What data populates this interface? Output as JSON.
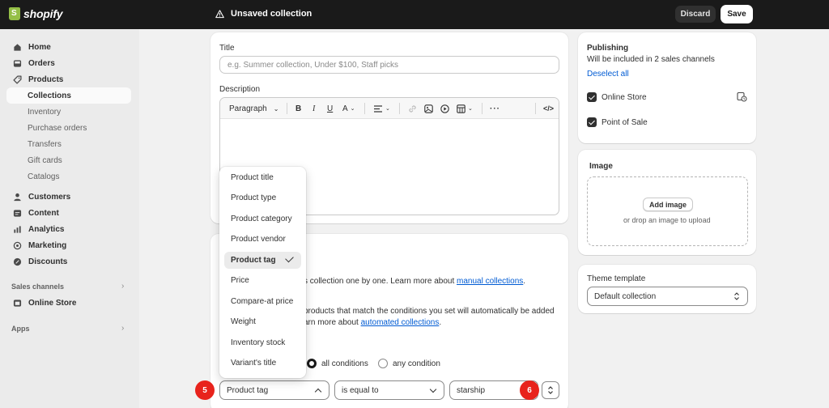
{
  "topbar": {
    "logo": "shopify",
    "title": "Unsaved collection",
    "discard_label": "Discard",
    "save_label": "Save"
  },
  "sidebar": {
    "items": [
      {
        "label": "Home",
        "icon": "home-icon"
      },
      {
        "label": "Orders",
        "icon": "inbox-icon"
      },
      {
        "label": "Products",
        "icon": "tag-icon"
      }
    ],
    "product_sub": [
      "Collections",
      "Inventory",
      "Purchase orders",
      "Transfers",
      "Gift cards",
      "Catalogs"
    ],
    "items2": [
      {
        "label": "Customers",
        "icon": "person-icon"
      },
      {
        "label": "Content",
        "icon": "content-icon"
      },
      {
        "label": "Analytics",
        "icon": "chart-icon"
      },
      {
        "label": "Marketing",
        "icon": "target-icon"
      },
      {
        "label": "Discounts",
        "icon": "discount-icon"
      }
    ],
    "sales_channels_title": "Sales channels",
    "online_store": "Online Store",
    "apps_title": "Apps"
  },
  "main": {
    "title_label": "Title",
    "title_placeholder": "e.g. Summer collection, Under $100, Staff picks",
    "description_label": "Description",
    "paragraph_label": "Paragraph",
    "dropdown": {
      "options": [
        "Product title",
        "Product type",
        "Product category",
        "Product vendor",
        "Product tag",
        "Price",
        "Compare-at price",
        "Weight",
        "Inventory stock",
        "Variant's title"
      ],
      "selected": "Product tag"
    },
    "manual_text": "s collection one by one. Learn more about ",
    "manual_link": "manual collections",
    "manual_period": ".",
    "auto_text1": "products that match the conditions you set will automatically be added",
    "auto_text2": "arn more about ",
    "auto_link": "automated collections",
    "auto_period": ".",
    "all_conditions": "all conditions",
    "any_condition": "any condition",
    "condition": {
      "field": "Product tag",
      "operator": "is equal to",
      "value": "starship"
    },
    "badge_5": "5",
    "badge_6": "6"
  },
  "publishing": {
    "title": "Publishing",
    "subtitle": "Will be included in 2 sales channels",
    "deselect": "Deselect all",
    "channels": [
      "Online Store",
      "Point of Sale"
    ]
  },
  "image": {
    "title": "Image",
    "add_label": "Add image",
    "drop_text": "or drop an image to upload"
  },
  "theme": {
    "title": "Theme template",
    "value": "Default collection"
  },
  "colors": {
    "topbar": "#1a1a1a",
    "link": "#005bd3",
    "badge": "#e8231c",
    "shopify_green": "#95bf47"
  }
}
